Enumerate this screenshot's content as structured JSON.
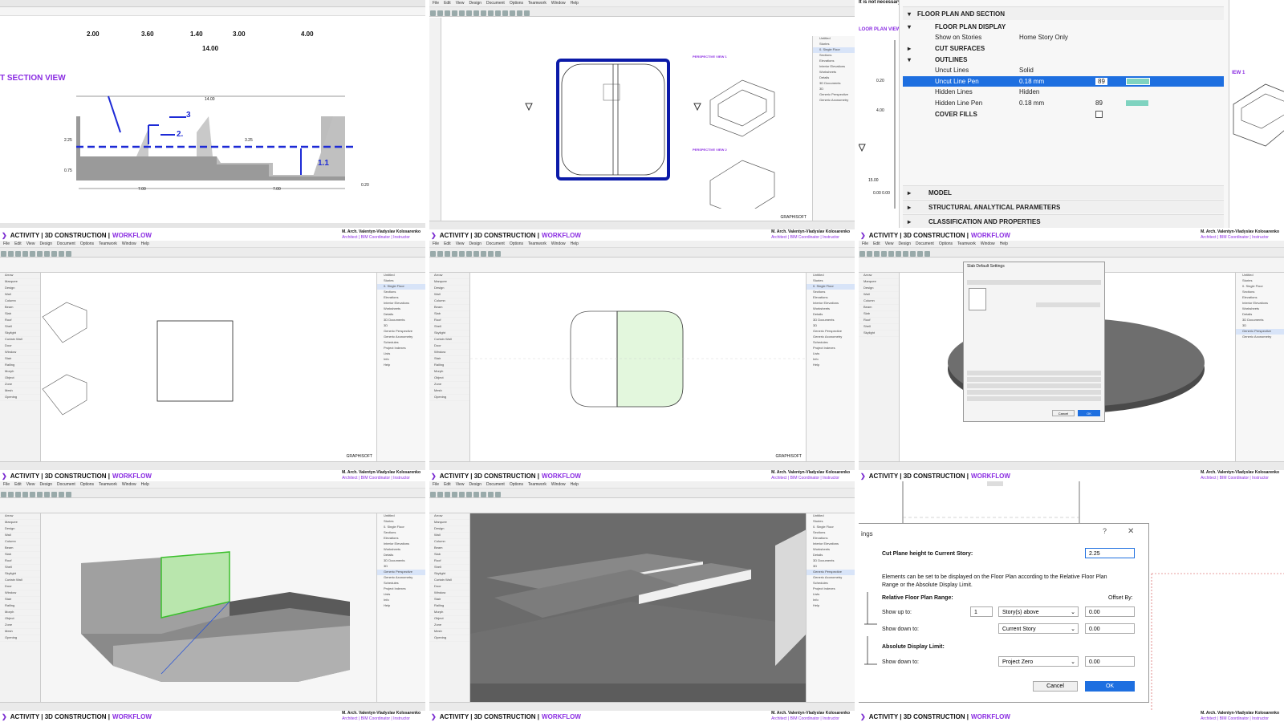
{
  "footer": {
    "activity": "ACTIVITY | 3D CONSTRUCTION |",
    "workflow": "WORKFLOW",
    "author": "M. Arch. Valentyn-Vladyslav Kolosarenko",
    "role": "Architect | BIM Coordinator | Instructor"
  },
  "tile1": {
    "section_label": "T SECTION VIEW",
    "top_dims": [
      "2.00",
      "3.60",
      "1.40",
      "3.00",
      "4.00"
    ],
    "total_dim": "14.00",
    "annotations": [
      "3",
      "2.",
      "1.1"
    ],
    "small_dims": [
      "7.00",
      "7.00",
      "2.25",
      "0.75",
      "3.25",
      "0.20",
      "14.00"
    ]
  },
  "tile2": {
    "labels": [
      "PERSPECTIVE VIEW 1",
      "PERSPECTIVE VIEW 2"
    ],
    "logo": "GRAPHISOFT"
  },
  "tile3": {
    "note": "It is not necessary to dim",
    "left_label": "LOOR PLAN VIEW",
    "right_label": "IEW 1",
    "dims": [
      "0.20",
      "4.00",
      "15.00",
      "0.00 0.00"
    ],
    "sections": {
      "floor_plan_and_section": "FLOOR PLAN AND SECTION",
      "floor_plan_display": "FLOOR PLAN DISPLAY",
      "show_on_stories_label": "Show on Stories",
      "show_on_stories_value": "Home Story Only",
      "cut_surfaces": "CUT SURFACES",
      "outlines": "OUTLINES",
      "cover_fills": "COVER FILLS",
      "model": "MODEL",
      "structural": "STRUCTURAL ANALYTICAL PARAMETERS",
      "classification": "CLASSIFICATION AND PROPERTIES"
    },
    "rows": [
      {
        "label": "Uncut Lines",
        "value": "Solid",
        "pen": ""
      },
      {
        "label": "Uncut Line Pen",
        "value": "0.18 mm",
        "pen": "89"
      },
      {
        "label": "Hidden Lines",
        "value": "Hidden",
        "pen": ""
      },
      {
        "label": "Hidden Line Pen",
        "value": "0.18 mm",
        "pen": "89"
      }
    ]
  },
  "tile6": {
    "dialog_title": "Slab Default Settings",
    "cancel": "Cancel",
    "ok": "OK"
  },
  "tile9": {
    "title": "ings",
    "cut_plane_label": "Cut Plane height to Current Story:",
    "cut_plane_value": "2.25",
    "description": "Elements can be set to be displayed on the Floor Plan according to the Relative Floor Plan Range or the Absolute Display Limit.",
    "relative_range": "Relative Floor Plan Range:",
    "offset_by": "Offset By:",
    "show_up_to": "Show up to:",
    "show_up_count": "1",
    "show_up_select": "Story(s) above",
    "show_up_offset": "0.00",
    "show_down_to": "Show down to:",
    "show_down_select": "Current Story",
    "show_down_offset": "0.00",
    "absolute_limit": "Absolute Display Limit:",
    "abs_show_down_to": "Show down to:",
    "abs_select": "Project Zero",
    "abs_offset": "0.00",
    "cancel": "Cancel",
    "ok": "OK",
    "help": "?",
    "close": "✕"
  },
  "menu": [
    "File",
    "Edit",
    "View",
    "Design",
    "Document",
    "Options",
    "Teamwork",
    "Window",
    "Help"
  ],
  "toolbox_items": [
    "Arrow",
    "Marquee",
    "Design",
    "Wall",
    "Column",
    "Beam",
    "Slab",
    "Roof",
    "Shell",
    "Skylight",
    "Curtain Wall",
    "Door",
    "Window",
    "Stair",
    "Railing",
    "Morph",
    "Object",
    "Zone",
    "Mesh",
    "Opening"
  ],
  "navigator_items": [
    "Untitled",
    "Stories",
    "0. Single Floor",
    "Sections",
    "Elevations",
    "Interior Elevations",
    "Worksheets",
    "Details",
    "3D Documents",
    "3D",
    "Generic Perspective",
    "Generic Axonometry",
    "Schedules",
    "Project Indexes",
    "Lists",
    "Info",
    "Help"
  ],
  "colors": {
    "purple": "#8a2be2",
    "selection_blue": "#1e6fe0",
    "green_select": "#7bd36a"
  }
}
